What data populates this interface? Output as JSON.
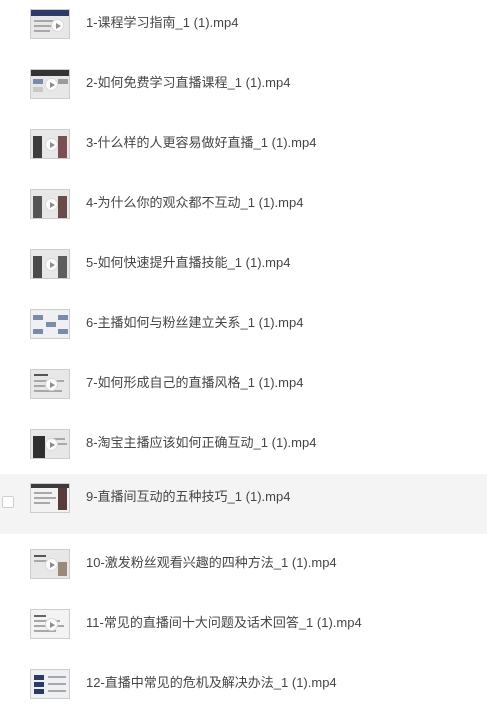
{
  "file_list": {
    "selected_index": 8,
    "items": [
      {
        "name": "1-课程学习指南_1 (1).mp4",
        "thumb_icon": "video-thumbnail-icon"
      },
      {
        "name": "2-如何免费学习直播课程_1 (1).mp4",
        "thumb_icon": "video-thumbnail-icon"
      },
      {
        "name": "3-什么样的人更容易做好直播_1 (1).mp4",
        "thumb_icon": "video-thumbnail-icon"
      },
      {
        "name": "4-为什么你的观众都不互动_1 (1).mp4",
        "thumb_icon": "video-thumbnail-icon"
      },
      {
        "name": "5-如何快速提升直播技能_1 (1).mp4",
        "thumb_icon": "video-thumbnail-icon"
      },
      {
        "name": "6-主播如何与粉丝建立关系_1 (1).mp4",
        "thumb_icon": "video-thumbnail-icon"
      },
      {
        "name": "7-如何形成自己的直播风格_1 (1).mp4",
        "thumb_icon": "video-thumbnail-icon"
      },
      {
        "name": "8-淘宝主播应该如何正确互动_1 (1).mp4",
        "thumb_icon": "video-thumbnail-icon"
      },
      {
        "name": "9-直播间互动的五种技巧_1 (1).mp4",
        "thumb_icon": "video-thumbnail-icon"
      },
      {
        "name": "10-激发粉丝观看兴趣的四种方法_1 (1).mp4",
        "thumb_icon": "video-thumbnail-icon"
      },
      {
        "name": "11-常见的直播间十大问题及话术回答_1 (1).mp4",
        "thumb_icon": "video-thumbnail-icon"
      },
      {
        "name": "12-直播中常见的危机及解决办法_1 (1).mp4",
        "thumb_icon": "video-thumbnail-icon"
      }
    ]
  }
}
